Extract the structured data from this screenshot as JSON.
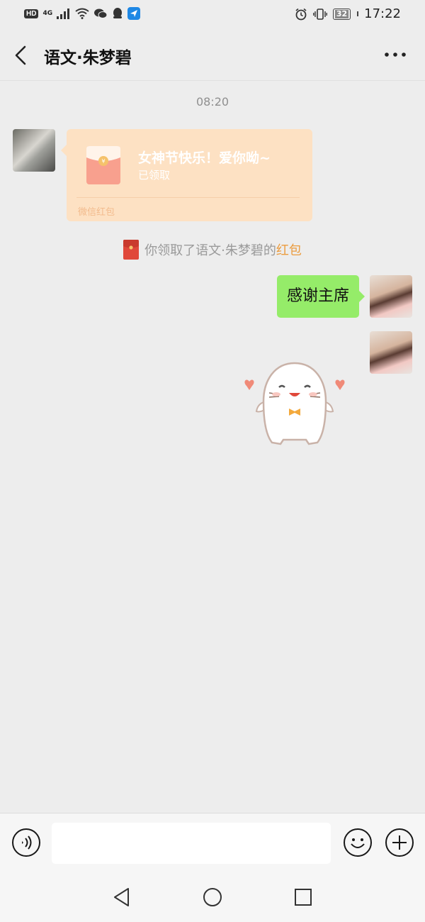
{
  "status_bar": {
    "badge": "HD",
    "network": "4G",
    "battery": "32",
    "time": "17:22"
  },
  "header": {
    "title": "语文·朱梦碧"
  },
  "chat": {
    "timestamp": "08:20",
    "red_packet": {
      "title": "女神节快乐！爱你呦~",
      "status": "已领取",
      "footer": "微信红包"
    },
    "system_message": {
      "prefix": "你领取了语文·朱梦碧的",
      "link": "红包"
    },
    "text_message": "感谢主席"
  },
  "colors": {
    "background": "#ededed",
    "red_packet_bg": "#fde1c3",
    "sent_bubble": "#95ec69",
    "link_orange": "#eb9c3f"
  },
  "icons": {
    "back": "back-arrow-icon",
    "more": "more-dots-icon",
    "voice": "voice-icon",
    "emoji": "emoji-icon",
    "plus": "plus-icon"
  }
}
